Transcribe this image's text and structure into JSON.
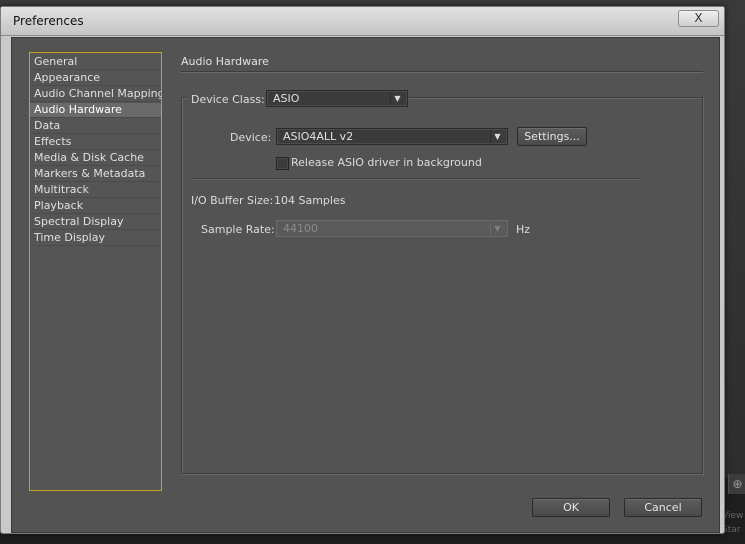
{
  "window": {
    "title": "Preferences",
    "close_glyph": "X"
  },
  "background": {
    "zoom_icon": "⊕",
    "hint_lines": [
      "View",
      "Star"
    ]
  },
  "sidebar": {
    "items": [
      {
        "label": "General"
      },
      {
        "label": "Appearance"
      },
      {
        "label": "Audio Channel Mapping"
      },
      {
        "label": "Audio Hardware",
        "selected": true
      },
      {
        "label": "Data"
      },
      {
        "label": "Effects"
      },
      {
        "label": "Media & Disk Cache"
      },
      {
        "label": "Markers & Metadata"
      },
      {
        "label": "Multitrack"
      },
      {
        "label": "Playback"
      },
      {
        "label": "Spectral Display"
      },
      {
        "label": "Time Display"
      }
    ]
  },
  "panel": {
    "section_title": "Audio Hardware",
    "device_class": {
      "label": "Device Class:",
      "value": "ASIO"
    },
    "device": {
      "label": "Device:",
      "value": "ASIO4ALL v2"
    },
    "settings_button": "Settings...",
    "release_checkbox": {
      "label": "Release ASIO driver in background",
      "checked": false
    },
    "buffer": {
      "label": "I/O Buffer Size:",
      "value": "104 Samples"
    },
    "sample_rate": {
      "label": "Sample Rate:",
      "value": "44100",
      "unit": "Hz",
      "enabled": false
    }
  },
  "footer": {
    "ok_label": "OK",
    "cancel_label": "Cancel"
  },
  "colors": {
    "client_bg": "#535353",
    "selection_border": "#c9a41a",
    "selected_item_bg": "#6a6a6a"
  }
}
